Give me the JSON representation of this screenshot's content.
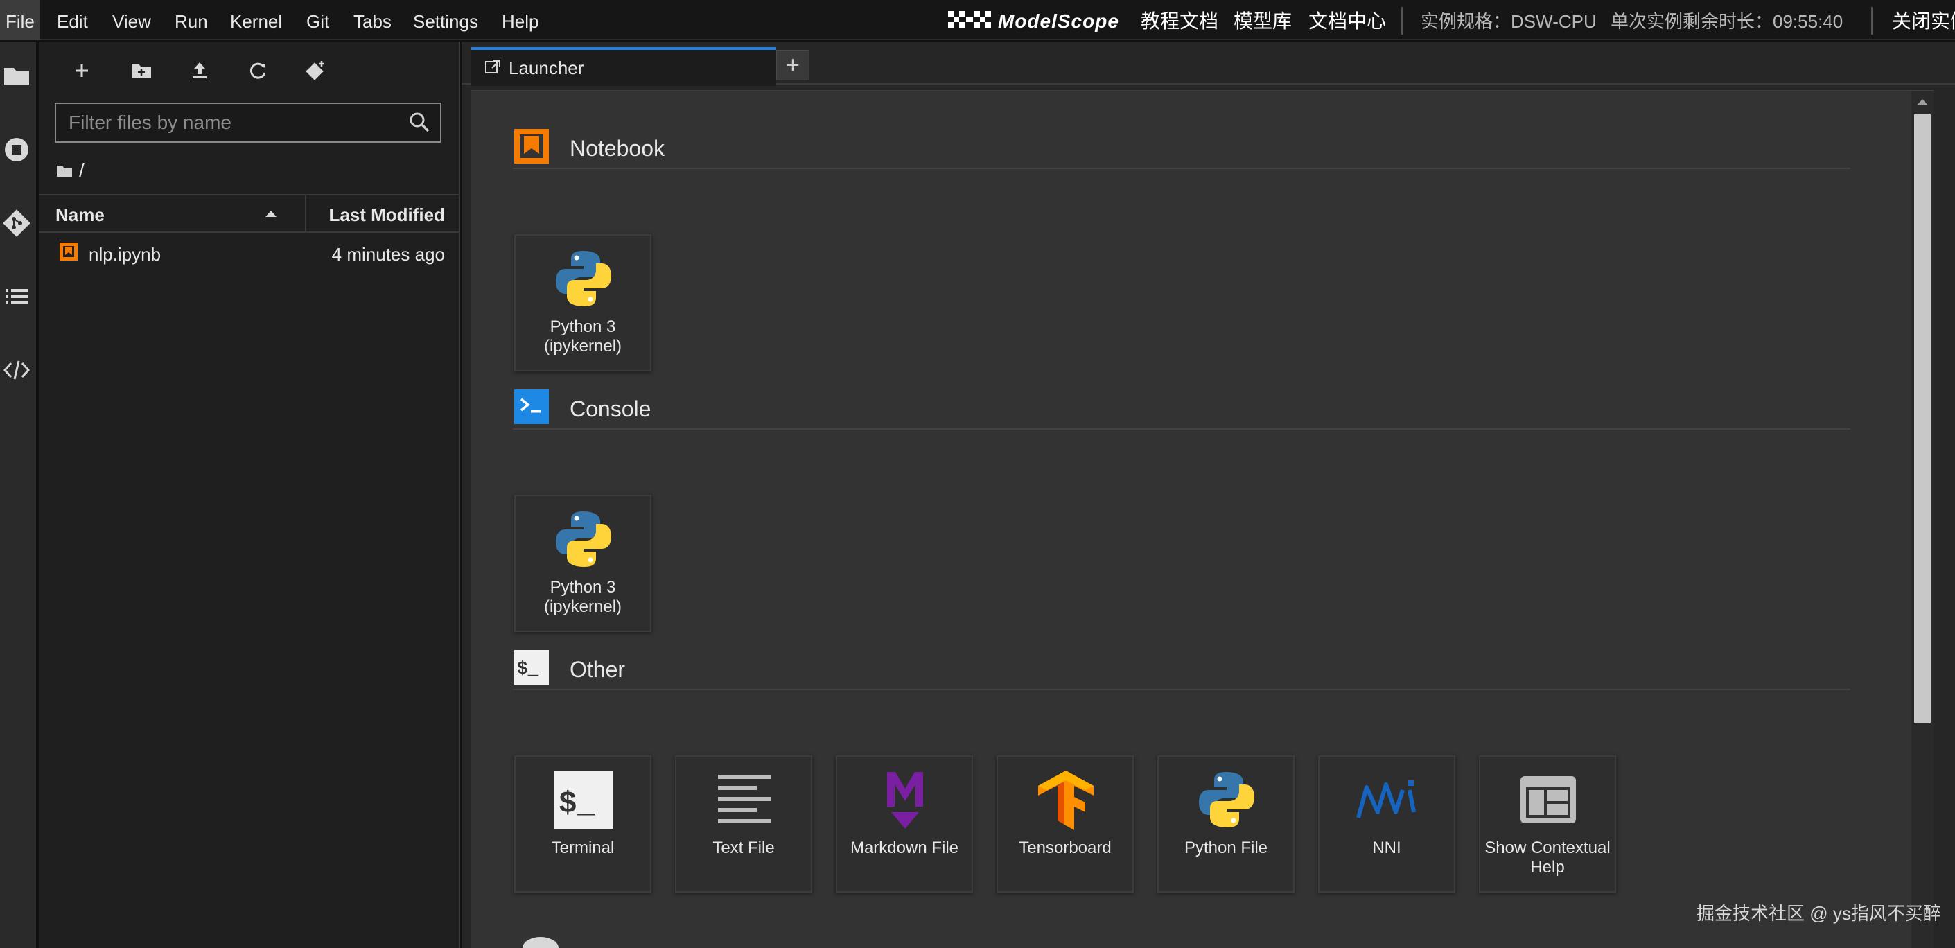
{
  "menubar": {
    "items": [
      "File",
      "Edit",
      "View",
      "Run",
      "Kernel",
      "Git",
      "Tabs",
      "Settings",
      "Help"
    ],
    "active": "File"
  },
  "brand": {
    "name": "ModelScope"
  },
  "top_links": {
    "tutorial": "教程文档",
    "model_hub": "模型库",
    "doc_center": "文档中心"
  },
  "instance": {
    "spec": "实例规格：DSW-CPU",
    "remaining": "单次实例剩余时长：09:55:40",
    "close_label": "关闭实例"
  },
  "activity_bar": [
    "folder-icon",
    "running-icon",
    "git-icon",
    "toc-icon",
    "extension-icon"
  ],
  "file_browser": {
    "toolbar": [
      "new-launcher-icon",
      "new-folder-icon",
      "upload-icon",
      "refresh-icon",
      "git-clone-icon"
    ],
    "filter_placeholder": "Filter files by name",
    "breadcrumb": "/",
    "columns": {
      "name": "Name",
      "modified": "Last Modified"
    },
    "files": [
      {
        "name": "nlp.ipynb",
        "modified": "4 minutes ago",
        "icon": "notebook-icon"
      }
    ]
  },
  "tabs": [
    {
      "label": "Launcher"
    }
  ],
  "launcher": {
    "sections": [
      {
        "title": "Notebook",
        "icon": "notebook-section-icon",
        "cards": [
          {
            "label": "Python 3\n(ipykernel)",
            "icon": "python-icon"
          }
        ]
      },
      {
        "title": "Console",
        "icon": "console-section-icon",
        "cards": [
          {
            "label": "Python 3\n(ipykernel)",
            "icon": "python-icon"
          }
        ]
      },
      {
        "title": "Other",
        "icon": "other-section-icon",
        "cards": [
          {
            "label": "Terminal",
            "icon": "terminal-icon"
          },
          {
            "label": "Text File",
            "icon": "text-file-icon"
          },
          {
            "label": "Markdown File",
            "icon": "markdown-icon"
          },
          {
            "label": "Tensorboard",
            "icon": "tensorboard-icon"
          },
          {
            "label": "Python File",
            "icon": "python-icon"
          },
          {
            "label": "NNI",
            "icon": "nni-icon"
          },
          {
            "label": "Show Contextual Help",
            "icon": "contextual-help-icon"
          }
        ]
      }
    ]
  },
  "watermark": "掘金技术社区 @ ys指风不买醉",
  "colors": {
    "accent_blue": "#2a7fd4",
    "notebook_orange": "#f57c00",
    "console_blue": "#1e88e5",
    "markdown_purple": "#7b1fa2",
    "tensorboard_orange": "#ff8f00",
    "nni_blue": "#1565c0"
  }
}
